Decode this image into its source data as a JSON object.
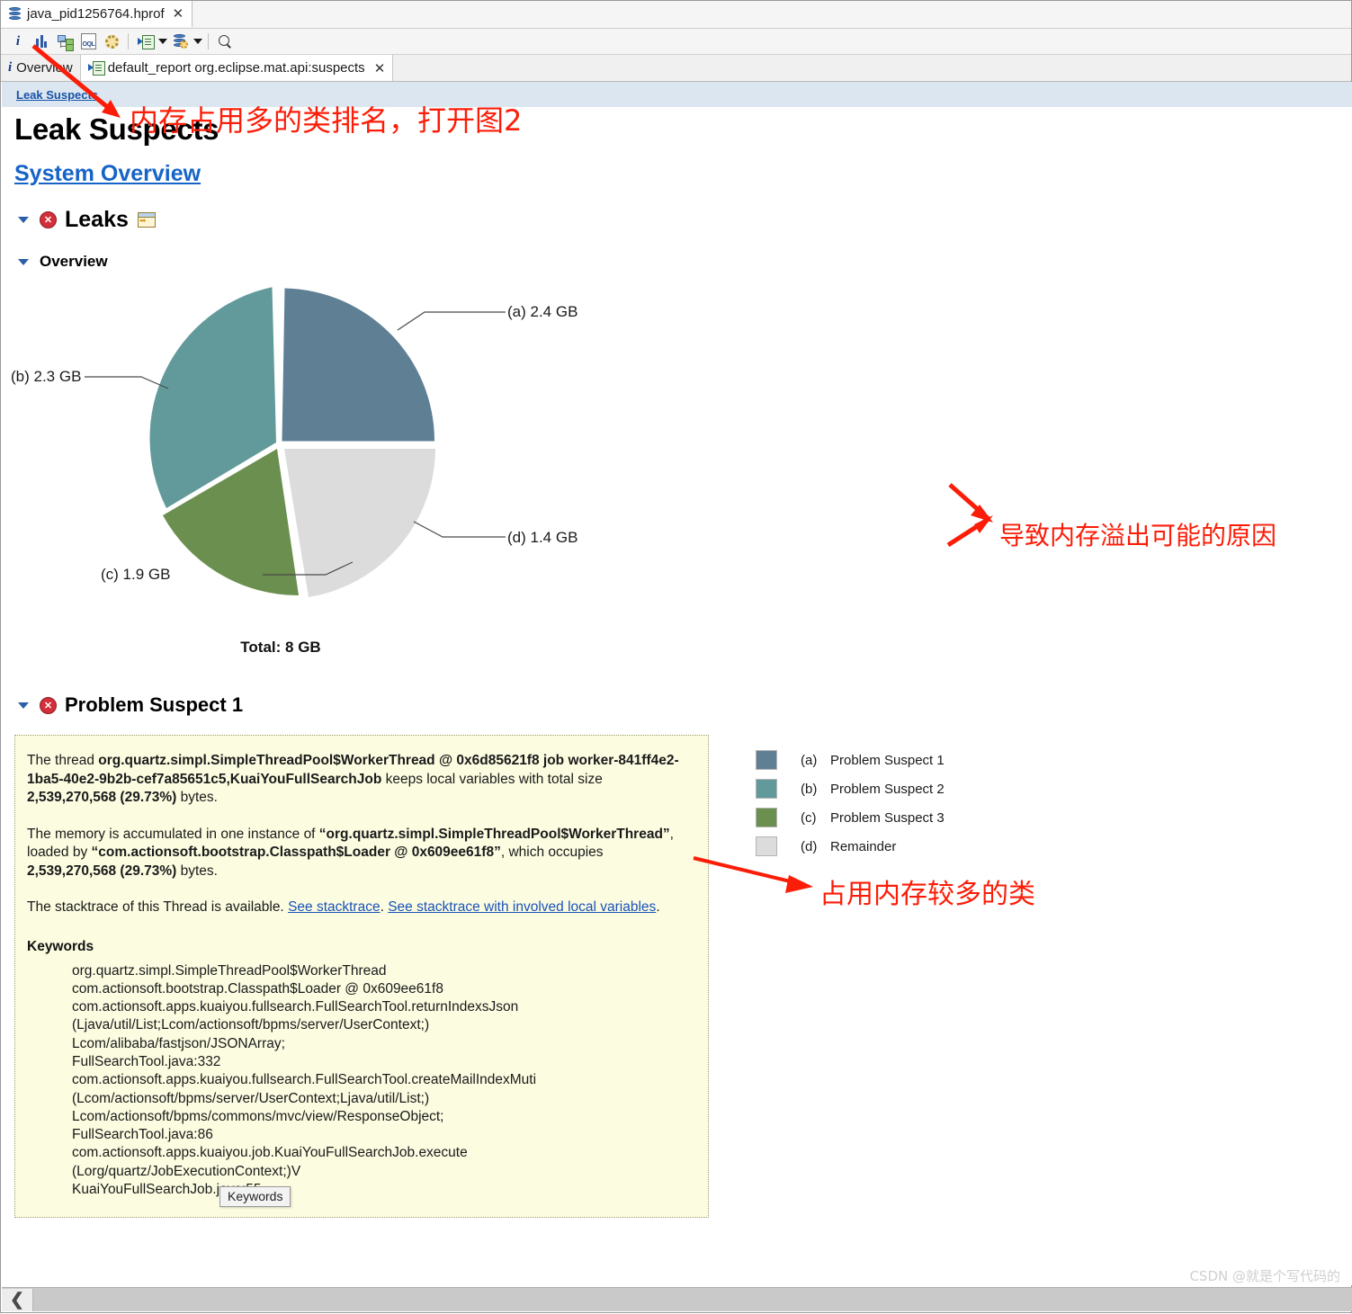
{
  "window": {
    "file_tab": {
      "label": "java_pid1256764.hprof",
      "close": "✕",
      "icon": "heap-dump-icon"
    }
  },
  "toolbar": {
    "items": [
      {
        "name": "overview-info-icon",
        "glyph": "i"
      },
      {
        "name": "histogram-icon",
        "glyph": "bars"
      },
      {
        "name": "dominator-tree-icon",
        "glyph": "tree"
      },
      {
        "name": "oql-icon",
        "glyph": "OQL"
      },
      {
        "name": "settings-gear-icon",
        "glyph": "gear"
      },
      {
        "name": "run-expert-system-test-icon",
        "glyph": "play-report"
      },
      {
        "name": "run-expert-system-dropdown",
        "glyph": "caret"
      },
      {
        "name": "query-browser-icon",
        "glyph": "db-gear"
      },
      {
        "name": "query-browser-dropdown",
        "glyph": "caret"
      },
      {
        "name": "search-icon",
        "glyph": "magnifier"
      }
    ]
  },
  "view_tabs": [
    {
      "name": "tab-overview",
      "label": "Overview",
      "icon": "info-icon",
      "active": false,
      "closable": false
    },
    {
      "name": "tab-default-report",
      "label": "default_report  org.eclipse.mat.api:suspects",
      "icon": "report-icon",
      "active": true,
      "closable": true,
      "close": "✕"
    }
  ],
  "breadcrumb": {
    "label": "Leak Suspects"
  },
  "page": {
    "title": "Leak Suspects",
    "system_overview_link": "System Overview"
  },
  "sections": {
    "leaks": {
      "label": "Leaks",
      "status": "error",
      "badge": "✕"
    },
    "overview": {
      "label": "Overview"
    },
    "problem_suspect_1": {
      "label": "Problem Suspect 1",
      "badge": "✕"
    }
  },
  "chart_data": {
    "type": "pie",
    "title": "",
    "total_label": "Total: 8 GB",
    "total_value": 8,
    "unit": "GB",
    "legend_position": "right",
    "categories": [
      "(a)",
      "(b)",
      "(c)",
      "(d)"
    ],
    "labels": [
      "Problem Suspect 1",
      "Problem Suspect 2",
      "Problem Suspect 3",
      "Remainder"
    ],
    "values": [
      2.4,
      2.3,
      1.9,
      1.4
    ],
    "value_labels": [
      "2.4 GB",
      "2.3 GB",
      "1.9 GB",
      "1.4 GB"
    ],
    "callout_labels": [
      "(a)  2.4 GB",
      "(b)  2.3 GB",
      "(c)  1.9 GB",
      "(d)  1.4 GB"
    ],
    "colors": [
      "#5f7f94",
      "#629a9c",
      "#6b8f4e",
      "#dcdcdc"
    ],
    "legend_entries": [
      {
        "key": "(a)",
        "label": "Problem Suspect 1",
        "color": "#5f7f94"
      },
      {
        "key": "(b)",
        "label": "Problem Suspect 2",
        "color": "#629a9c"
      },
      {
        "key": "(c)",
        "label": "Problem Suspect 3",
        "color": "#6b8f4e"
      },
      {
        "key": "(d)",
        "label": "Remainder",
        "color": "#dcdcdc"
      }
    ]
  },
  "suspect": {
    "para1_a": "The thread ",
    "para1_b": "org.quartz.simpl.SimpleThreadPool$WorkerThread @ 0x6d85621f8 job worker-841ff4e2-1ba5-40e2-9b2b-cef7a85651c5,KuaiYouFullSearchJob",
    "para1_c": " keeps local variables with total size ",
    "para1_d": "2,539,270,568 (29.73%)",
    "para1_e": " bytes.",
    "para2_a": "The memory is accumulated in one instance of ",
    "para2_b": "“org.quartz.simpl.SimpleThreadPool$WorkerThread”",
    "para2_c": ", loaded by ",
    "para2_d": "“com.actionsoft.bootstrap.Classpath$Loader @ 0x609ee61f8”",
    "para2_e": ", which occupies ",
    "para2_f": "2,539,270,568 (29.73%)",
    "para2_g": " bytes.",
    "para3_a": "The stacktrace of this Thread is available. ",
    "link1": "See stacktrace",
    "para3_b": ". ",
    "link2": "See stacktrace with involved local variables",
    "para3_c": ".",
    "keywords_title": "Keywords",
    "keywords": "org.quartz.simpl.SimpleThreadPool$WorkerThread\ncom.actionsoft.bootstrap.Classpath$Loader @ 0x609ee61f8\ncom.actionsoft.apps.kuaiyou.fullsearch.FullSearchTool.returnIndexsJson\n(Ljava/util/List;Lcom/actionsoft/bpms/server/UserContext;)\nLcom/alibaba/fastjson/JSONArray;\nFullSearchTool.java:332\ncom.actionsoft.apps.kuaiyou.fullsearch.FullSearchTool.createMailIndexMuti\n(Lcom/actionsoft/bpms/server/UserContext;Ljava/util/List;)\nLcom/actionsoft/bpms/commons/mvc/view/ResponseObject;\nFullSearchTool.java:86\ncom.actionsoft.apps.kuaiyou.job.KuaiYouFullSearchJob.execute\n(Lorg/quartz/JobExecutionContext;)V\nKuaiYouFullSearchJob.java:55"
  },
  "tooltip": {
    "text": "Keywords"
  },
  "annotations": [
    {
      "name": "annotation-top",
      "text": "内存占用多的类排名，打开图2",
      "color": "#fb1d08"
    },
    {
      "name": "annotation-legend",
      "text": "导致内存溢出可能的原因",
      "color": "#fb1d08"
    },
    {
      "name": "annotation-suspect",
      "text": "占用内存较多的类",
      "color": "#fb1d08"
    }
  ],
  "scrollbar": {
    "left_arrow": "❮"
  },
  "watermark": {
    "text": "CSDN @就是个写代码的"
  }
}
